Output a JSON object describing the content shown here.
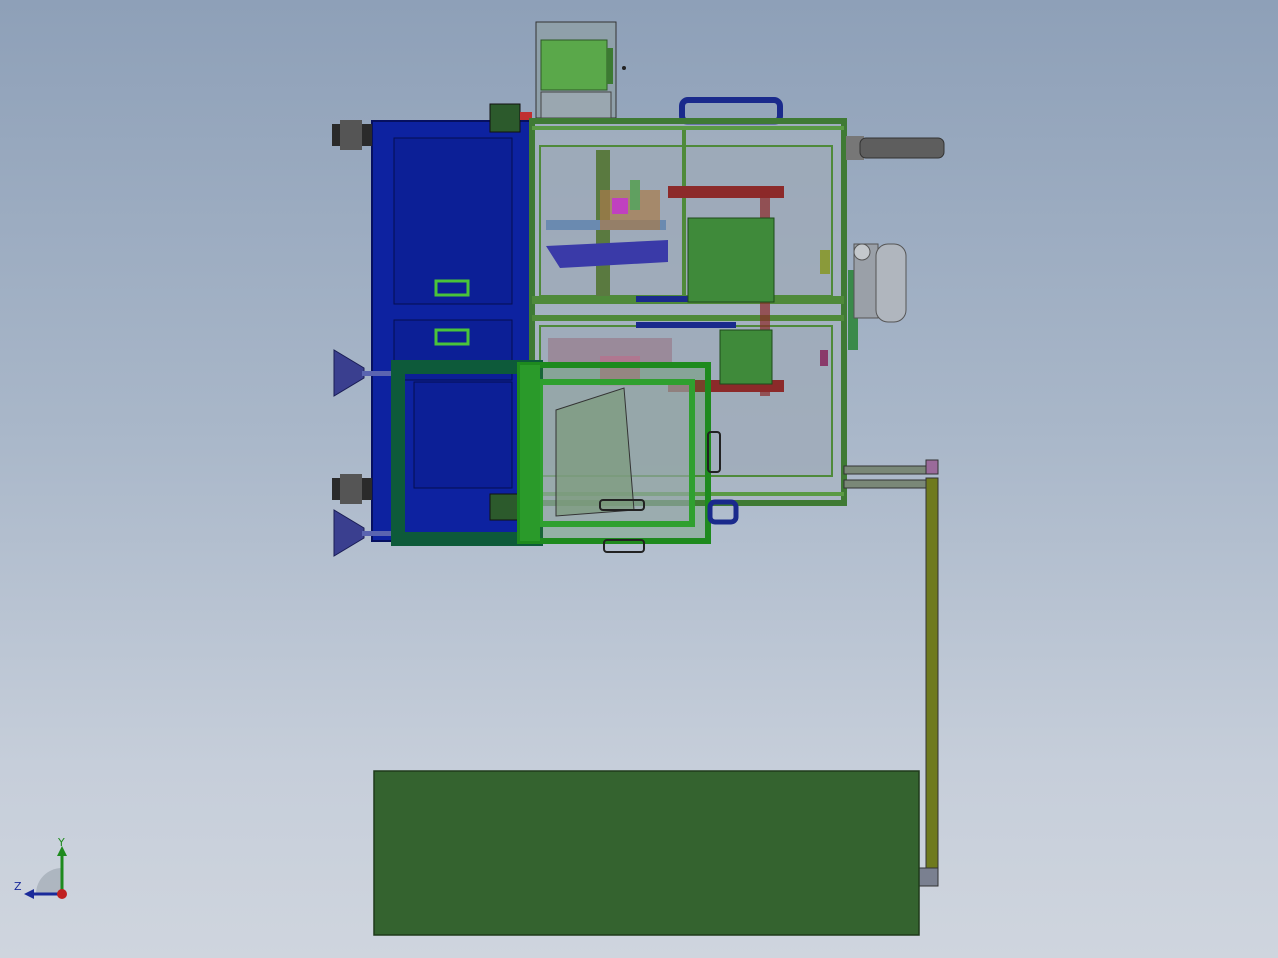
{
  "viewport": {
    "axis_triad": {
      "y_label": "Y",
      "z_label": "Z"
    }
  },
  "colors": {
    "cabinet_blue": "#0b1f9c",
    "frame_green": "#4f8a3a",
    "panel_green": "#34632f",
    "rail_olive": "#6f7a1e",
    "cup_purple": "#3a3f8f",
    "accent_red": "#8c2a2a"
  },
  "icons": {
    "triad": "axis-triad-icon"
  }
}
